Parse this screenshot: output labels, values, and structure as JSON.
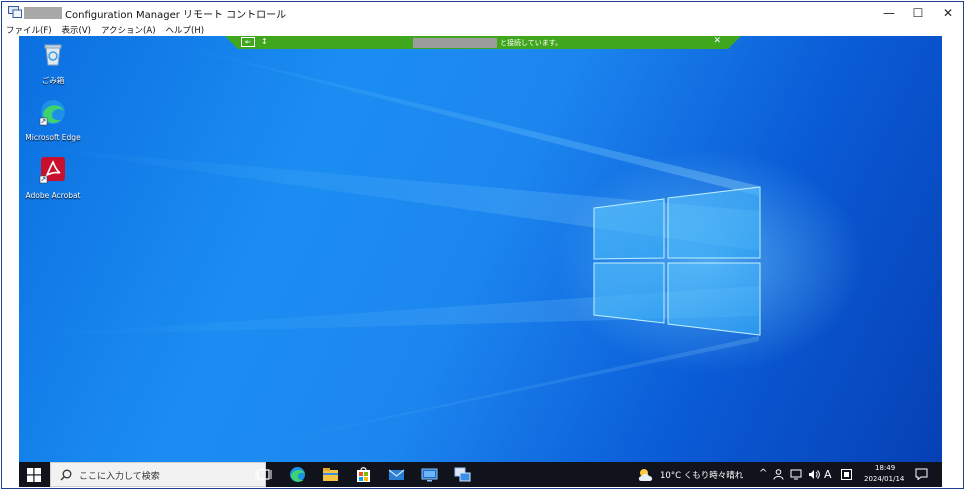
{
  "window": {
    "title": "Configuration Manager リモート コントロール",
    "controls": {
      "minimize": "—",
      "maximize": "☐",
      "close": "✕"
    }
  },
  "menu": {
    "items": [
      "ファイル(F)",
      "表示(V)",
      "アクション(A)",
      "ヘルプ(H)"
    ]
  },
  "connection_bar": {
    "pin_glyph": "⇤",
    "mark": "↕",
    "message": "と接続しています。",
    "close": "✕",
    "color": "#3fa61e"
  },
  "desktop": {
    "icons": [
      {
        "name": "recycle-bin",
        "label": "ごみ箱"
      },
      {
        "name": "microsoft-edge",
        "label": "Microsoft Edge"
      },
      {
        "name": "adobe-acrobat",
        "label": "Adobe Acrobat"
      }
    ]
  },
  "taskbar": {
    "search_placeholder": "ここに入力して検索",
    "apps": [
      "task-view",
      "edge",
      "file-explorer",
      "store",
      "mail",
      "remote-control",
      "config-manager"
    ],
    "weather_text": "10°C くもり時々晴れ",
    "tray_glyphs": {
      "chevron": "^",
      "ime": "A"
    },
    "time": "18:49",
    "date": "2024/01/14"
  }
}
